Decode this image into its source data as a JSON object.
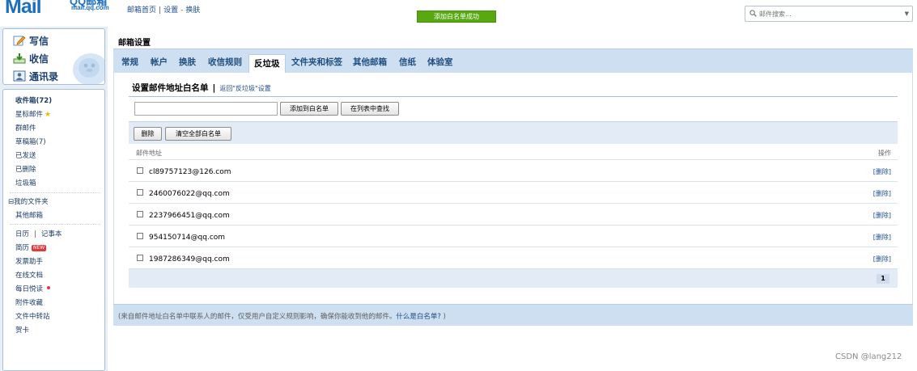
{
  "header": {
    "logo_big": "Mail",
    "logo_small": "QQ邮箱",
    "logo_url": "mail.qq.com",
    "links": [
      "邮箱首页",
      "设置",
      "换肤"
    ],
    "toast": "添加白名单成功",
    "search_placeholder": "邮件搜索..."
  },
  "sidebar": {
    "quick": [
      {
        "label": "写信",
        "icon": "pencil-icon"
      },
      {
        "label": "收信",
        "icon": "inbox-download-icon"
      },
      {
        "label": "通讯录",
        "icon": "contacts-icon"
      }
    ],
    "folders": {
      "inbox": "收件箱(72)",
      "starred": "星标邮件",
      "group": "群邮件",
      "drafts": "草稿箱(7)",
      "sent": "已发送",
      "deleted": "已删除",
      "spam": "垃圾箱",
      "my_folders": "⊟我的文件夹",
      "other_mailbox": "其他邮箱",
      "calendar": "日历",
      "notebook": "记事本",
      "resume": "简历",
      "resume_badge": "NEW",
      "invoice": "发票助手",
      "online_docs": "在线文档",
      "daily_reading": "每日悦读",
      "attachments": "附件收藏",
      "file_transfer": "文件中转站",
      "cards": "贺卡"
    }
  },
  "main": {
    "title": "邮箱设置",
    "tabs": [
      "常规",
      "帐户",
      "换肤",
      "收信规则",
      "反垃圾",
      "文件夹和标签",
      "其他邮箱",
      "信纸",
      "体验室"
    ],
    "active_tab": "反垃圾",
    "section_title": "设置邮件地址白名单",
    "back_link": "返回\"反垃圾\"设置",
    "add_value": "",
    "add_button": "添加到白名单",
    "find_button": "在列表中查找",
    "delete_button": "删除",
    "clear_button": "清空全部白名单",
    "col_address": "邮件地址",
    "col_action": "操作",
    "rows": [
      {
        "address": "cl89757123@126.com",
        "action": "[删除]"
      },
      {
        "address": "2460076022@qq.com",
        "action": "[删除]"
      },
      {
        "address": "2237966451@qq.com",
        "action": "[删除]"
      },
      {
        "address": "954150714@qq.com",
        "action": "[删除]"
      },
      {
        "address": "1987286349@qq.com",
        "action": "[删除]"
      }
    ],
    "page": "1",
    "footer_note": "(来自邮件地址白名单中联系人的邮件，仅受用户自定义规则影响，确保你能收到他的邮件。",
    "footer_link": "什么是白名单?",
    "footer_close": " )"
  },
  "watermark": "CSDN @lang212"
}
